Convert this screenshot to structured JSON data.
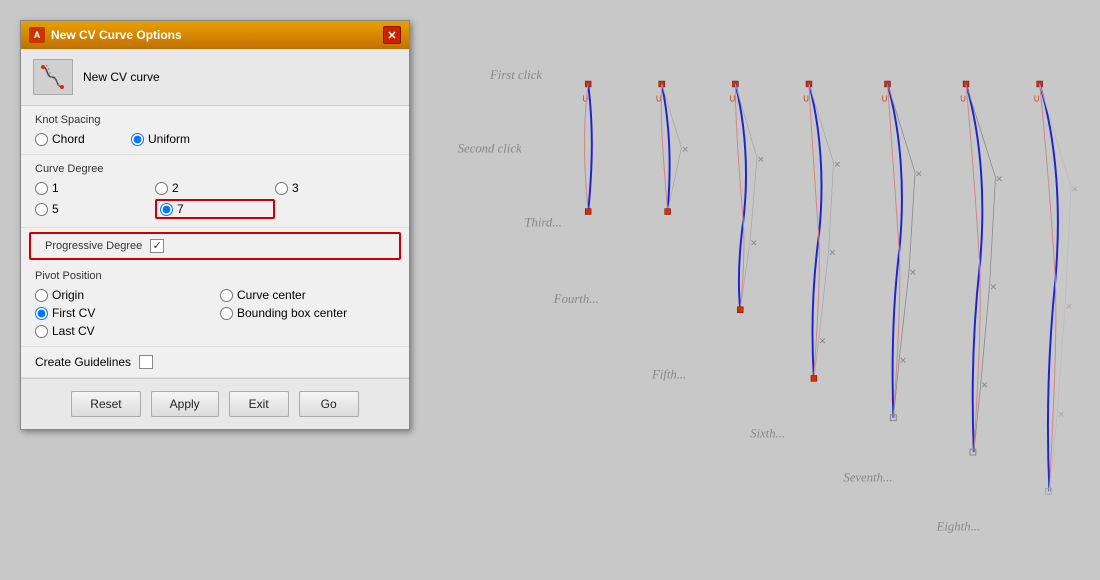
{
  "dialog": {
    "title": "New CV Curve Options",
    "header_label": "New CV curve",
    "sections": {
      "knot_spacing": {
        "label": "Knot Spacing",
        "options": [
          "Chord",
          "Uniform"
        ],
        "selected": "Uniform"
      },
      "curve_degree": {
        "label": "Curve Degree",
        "options": [
          "1",
          "2",
          "3",
          "5",
          "7"
        ],
        "selected": "7"
      },
      "progressive_degree": {
        "label": "Progressive Degree",
        "checked": true
      },
      "pivot_position": {
        "label": "Pivot Position",
        "options": [
          "Origin",
          "Curve center",
          "First CV",
          "Bounding box center",
          "Last CV"
        ],
        "selected": "First CV"
      },
      "create_guidelines": {
        "label": "Create Guidelines",
        "checked": false
      }
    },
    "buttons": {
      "reset": "Reset",
      "apply": "Apply",
      "exit": "Exit",
      "go": "Go"
    }
  },
  "diagram": {
    "labels": [
      "First click",
      "Second click",
      "Third...",
      "Fourth...",
      "Fifth...",
      "Sixth...",
      "Seventh...",
      "Eighth..."
    ]
  }
}
